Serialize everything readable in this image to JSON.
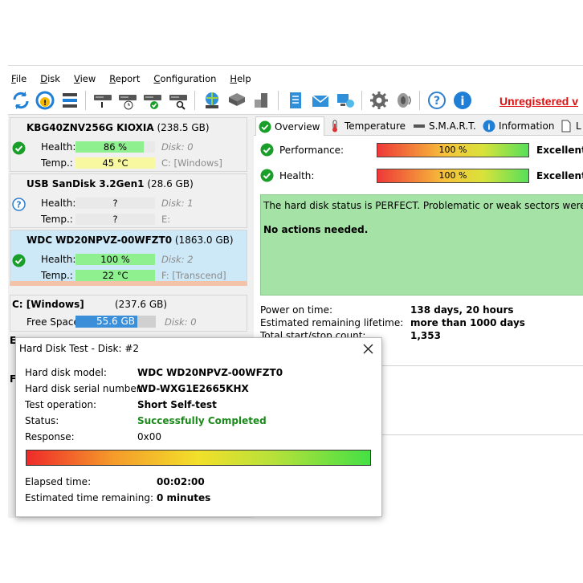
{
  "menu": [
    {
      "first": "F",
      "rest": "ile"
    },
    {
      "first": "D",
      "rest": "isk"
    },
    {
      "first": "V",
      "rest": "iew"
    },
    {
      "first": "R",
      "rest": "eport"
    },
    {
      "first": "C",
      "rest": "onfiguration"
    },
    {
      "first": "H",
      "rest": "elp"
    }
  ],
  "toolbar": {
    "unregistered": "Unregistered v"
  },
  "disks": [
    {
      "name": "KBG40ZNV256G KIOXIA",
      "size": "(238.5 GB)",
      "health": "86 %",
      "health_level": 86,
      "health_color": "#8ef08e",
      "disk": "Disk: 0",
      "temp": "45 °C",
      "temp_color": "#f8f8a0",
      "volume": "C: [Windows]",
      "health_label": "Health:",
      "temp_label": "Temp.:"
    },
    {
      "name": "USB SanDisk 3.2Gen1",
      "size": "(28.6 GB)",
      "health": "?",
      "health_level": 0,
      "disk": "Disk: 1",
      "temp": "?",
      "volume": "E:",
      "health_label": "Health:",
      "temp_label": "Temp.:"
    },
    {
      "name": "WDC WD20NPVZ-00WFZT0",
      "size": "(1863.0 GB)",
      "health": "100 %",
      "health_level": 100,
      "health_color": "#8ef08e",
      "disk": "Disk: 2",
      "temp": "22 °C",
      "temp_color": "#8ef08e",
      "volume": "F: [Transcend]",
      "health_label": "Health:",
      "temp_label": "Temp.:"
    }
  ],
  "partition": {
    "title": "C: [Windows]",
    "size": "(237.6 GB)",
    "free_label": "Free Space",
    "free": "55.6 GB",
    "free_fraction": 0.77,
    "disk": "Disk: 0"
  },
  "edge": {
    "e": "E",
    "f": "F"
  },
  "tabs": [
    "Overview",
    "Temperature",
    "S.M.A.R.T.",
    "Information",
    "L"
  ],
  "overview": {
    "performance_label": "Performance:",
    "performance_value": "100 %",
    "performance_word": "Excellent",
    "health_label": "Health:",
    "health_value": "100 %",
    "health_word": "Excellent",
    "message": "The hard disk status is PERFECT. Problematic or weak sectors were no",
    "action": "No actions needed.",
    "info": [
      {
        "label": "Power on time:",
        "value": "138 days, 20 hours"
      },
      {
        "label": "Estimated remaining lifetime:",
        "value": "more than 1000 days"
      },
      {
        "label": "Total start/stop count:",
        "value": "1,353"
      }
    ]
  },
  "dialog": {
    "title": "Hard Disk Test - Disk: #2",
    "rows": [
      {
        "label": "Hard disk model:",
        "value": "WDC WD20NPVZ-00WFZT0"
      },
      {
        "label": "Hard disk serial number:",
        "value": "WD-WXG1E2665KHX"
      },
      {
        "label": "Test operation:",
        "value": "Short Self-test"
      },
      {
        "label": "Status:",
        "value": "Successfully Completed"
      },
      {
        "label": "Response:",
        "value": "0x00"
      }
    ],
    "progress": 100,
    "elapsed_label": "Elapsed time:",
    "elapsed": "00:02:00",
    "remaining_label": "Estimated time remaining:",
    "remaining": "0 minutes"
  },
  "colors": {
    "ok_green": "#1a9e2a",
    "error_red": "#d11",
    "selected_bg": "#cde8f7"
  }
}
